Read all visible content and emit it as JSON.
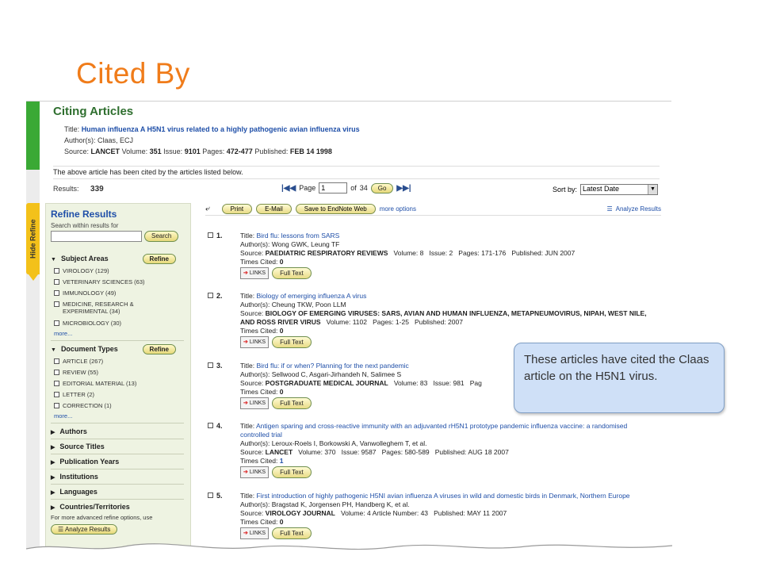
{
  "slide": {
    "title": "Cited By"
  },
  "callout": {
    "text": "These articles have cited the Claas article on the H5N1 virus."
  },
  "panel": {
    "heading": "Citing Articles",
    "title_label": "Title:",
    "title_value": "Human influenza A H5N1 virus related to a highly pathogenic avian influenza virus",
    "authors_label": "Author(s):",
    "authors_value": "Claas, ECJ",
    "source_label": "Source:",
    "source_value": "LANCET",
    "volume_label": "Volume:",
    "volume_value": "351",
    "issue_label": "Issue:",
    "issue_value": "9101",
    "pages_label": "Pages:",
    "pages_value": "472-477",
    "published_label": "Published:",
    "published_value": "FEB 14 1998",
    "note": "The above article has been cited by the articles listed below.",
    "results_label": "Results:",
    "results_value": "339",
    "page_label": "Page",
    "page_value": "1",
    "of_label": "of",
    "of_value": "34",
    "go_label": "Go",
    "sortby_label": "Sort by:",
    "sortby_value": "Latest Date",
    "hide_refine": "Hide Refine"
  },
  "toolbar": {
    "print": "Print",
    "email": "E-Mail",
    "endnote": "Save to EndNote Web",
    "more_options": "more options",
    "analyze": "Analyze Results"
  },
  "refine": {
    "heading": "Refine Results",
    "search_label": "Search within results for",
    "search_button": "Search",
    "subject_areas": "Subject Areas",
    "refine_button": "Refine",
    "subjects": [
      "VIROLOGY (129)",
      "VETERINARY SCIENCES (63)",
      "IMMUNOLOGY (49)",
      "MEDICINE, RESEARCH & EXPERIMENTAL (34)",
      "MICROBIOLOGY (30)"
    ],
    "more": "more...",
    "document_types": "Document Types",
    "doctypes": [
      "ARTICLE (267)",
      "REVIEW (55)",
      "EDITORIAL MATERIAL (13)",
      "LETTER (2)",
      "CORRECTION (1)"
    ],
    "sections": [
      "Authors",
      "Source Titles",
      "Publication Years",
      "Institutions",
      "Languages",
      "Countries/Territories"
    ],
    "advanced_note": "For more advanced refine options, use",
    "analyze_button": "Analyze Results"
  },
  "records": [
    {
      "num": "1.",
      "title": "Bird flu: lessons from SARS",
      "authors": "Wong GWK, Leung TF",
      "source": "PAEDIATRIC RESPIRATORY REVIEWS",
      "details": "Volume: 8   Issue: 2   Pages: 171-176   Published: JUN 2007",
      "cited": "0"
    },
    {
      "num": "2.",
      "title": "Biology of emerging influenza A virus",
      "authors": "Cheung TKW, Poon LLM",
      "source": "BIOLOGY OF EMERGING VIRUSES: SARS, AVIAN AND HUMAN INFLUENZA, METAPNEUMOVIRUS, NIPAH, WEST NILE, AND ROSS RIVER VIRUS",
      "details": "Volume: 1102   Pages: 1-25   Published: 2007",
      "cited": "0"
    },
    {
      "num": "3.",
      "title": "Bird flu: if or when? Planning for the next pandemic",
      "authors": "Sellwood C, Asgari-Jirhandeh N, Salimee S",
      "source": "POSTGRADUATE MEDICAL JOURNAL",
      "details": "Volume: 83   Issue: 981   Pag",
      "cited": "0"
    },
    {
      "num": "4.",
      "title": "Antigen sparing and cross-reactive immunity with an adjuvanted rH5N1 prototype pandemic influenza vaccine: a randomised controlled trial",
      "authors": "Leroux-Roels I, Borkowski A, Vanwolleghem T, et al.",
      "source": "LANCET",
      "details": "Volume: 370   Issue: 9587   Pages: 580-589   Published: AUG 18 2007",
      "cited": "1"
    },
    {
      "num": "5.",
      "title": "First introduction of highly pathogenic H5NI avian influenza A viruses in wild and domestic birds in Denmark, Northern Europe",
      "authors": "Bragstad K, Jorgensen PH, Handberg K, et al.",
      "source": "VIROLOGY JOURNAL",
      "details": "Volume: 4 Article Number: 43   Published: MAY 11 2007",
      "cited": "0"
    }
  ],
  "labels": {
    "title": "Title:",
    "authors": "Author(s):",
    "source": "Source:",
    "cited": "Times Cited:",
    "links": "LINKS",
    "fulltext": "Full Text"
  }
}
